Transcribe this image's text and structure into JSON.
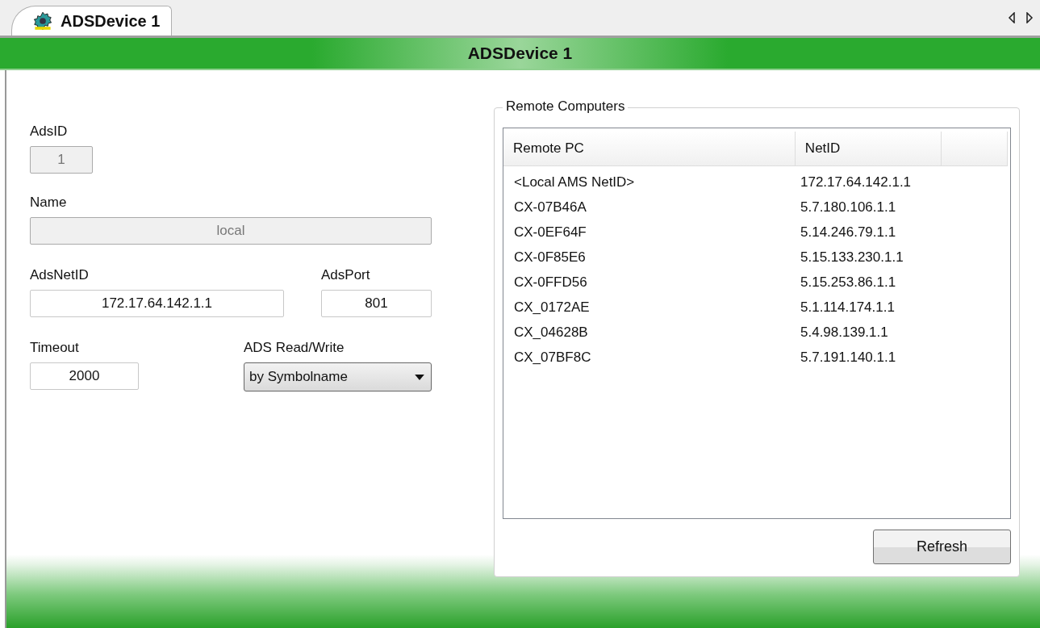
{
  "tabs": [
    {
      "title": "ADSDevice 1",
      "selected": true
    }
  ],
  "header": {
    "title": "ADSDevice 1"
  },
  "ads_id": {
    "label": "AdsID",
    "value": "1",
    "disabled": true
  },
  "name": {
    "label": "Name",
    "value": "local",
    "disabled": true
  },
  "ads_net_id": {
    "label": "AdsNetID",
    "value": "172.17.64.142.1.1",
    "disabled": false
  },
  "ads_port": {
    "label": "AdsPort",
    "value": "801",
    "disabled": false
  },
  "timeout": {
    "label": "Timeout",
    "value": "2000",
    "disabled": false
  },
  "ads_read_write": {
    "label": "ADS Read/Write",
    "value": "by Symbolname"
  },
  "remote_computers": {
    "title": "Remote Computers",
    "columns": [
      "Remote PC",
      "NetID"
    ],
    "rows": [
      {
        "remote_pc": "<Local AMS NetID>",
        "net_id": "172.17.64.142.1.1"
      },
      {
        "remote_pc": "CX-07B46A",
        "net_id": "5.7.180.106.1.1"
      },
      {
        "remote_pc": "CX-0EF64F",
        "net_id": "5.14.246.79.1.1"
      },
      {
        "remote_pc": "CX-0F85E6",
        "net_id": "5.15.133.230.1.1"
      },
      {
        "remote_pc": "CX-0FFD56",
        "net_id": "5.15.253.86.1.1"
      },
      {
        "remote_pc": "CX_0172AE",
        "net_id": "5.1.114.174.1.1"
      },
      {
        "remote_pc": "CX_04628B",
        "net_id": "5.4.98.139.1.1"
      },
      {
        "remote_pc": "CX_07BF8C",
        "net_id": "5.7.191.140.1.1"
      }
    ]
  },
  "refresh_button": "Refresh"
}
